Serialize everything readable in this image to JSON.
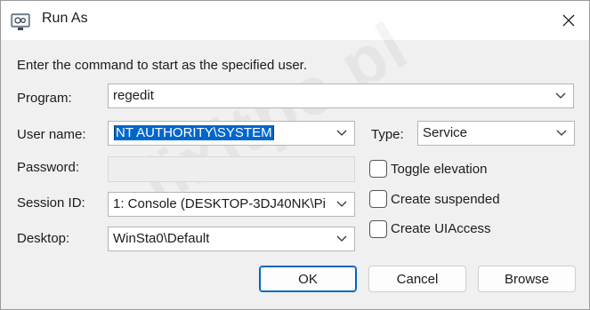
{
  "window": {
    "title": "Run As",
    "icon": "run-as-app-icon"
  },
  "instruction": "Enter the command to start as the specified user.",
  "fields": {
    "program": {
      "label": "Program:",
      "value": "regedit"
    },
    "username": {
      "label": "User name:",
      "value": "NT AUTHORITY\\SYSTEM"
    },
    "type": {
      "label": "Type:",
      "value": "Service"
    },
    "password": {
      "label": "Password:",
      "value": ""
    },
    "session": {
      "label": "Session ID:",
      "value": "1: Console (DESKTOP-3DJ40NK\\Pi"
    },
    "desktop": {
      "label": "Desktop:",
      "value": "WinSta0\\Default"
    }
  },
  "options": [
    {
      "label": "Toggle elevation",
      "checked": false
    },
    {
      "label": "Create suspended",
      "checked": false
    },
    {
      "label": "Create UIAccess",
      "checked": false
    }
  ],
  "buttons": {
    "ok": "OK",
    "cancel": "Cancel",
    "browse": "Browse"
  },
  "watermark": "fixitpc.pl",
  "colors": {
    "accent": "#0067c0",
    "selection": "#0066cc",
    "dialog_bg": "#f0f0f0"
  }
}
